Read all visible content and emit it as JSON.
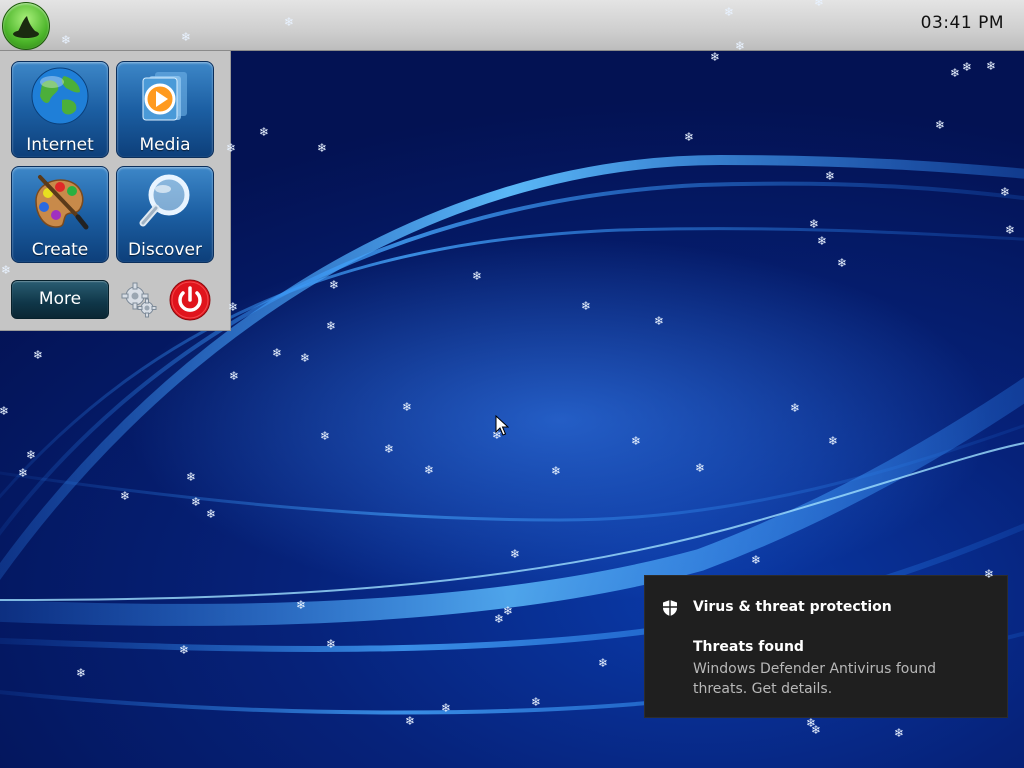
{
  "topbar": {
    "clock": "03:41 PM"
  },
  "start_menu": {
    "tiles": [
      {
        "label": "Internet",
        "icon": "globe-icon"
      },
      {
        "label": "Media",
        "icon": "play-icon"
      },
      {
        "label": "Create",
        "icon": "paint-palette-icon"
      },
      {
        "label": "Discover",
        "icon": "magnifier-icon"
      }
    ],
    "more_label": "More",
    "settings_icon": "gear-icon",
    "power_icon": "power-icon"
  },
  "notification": {
    "app_name": "Virus & threat protection",
    "title": "Threats found",
    "body": "Windows Defender Antivirus found threats. Get details.",
    "icon": "shield-icon"
  },
  "colors": {
    "desktop_deep": "#031253",
    "desktop_glow": "#3c8cff",
    "toast_background": "#1f1f1f",
    "power_red": "#e0141c"
  }
}
